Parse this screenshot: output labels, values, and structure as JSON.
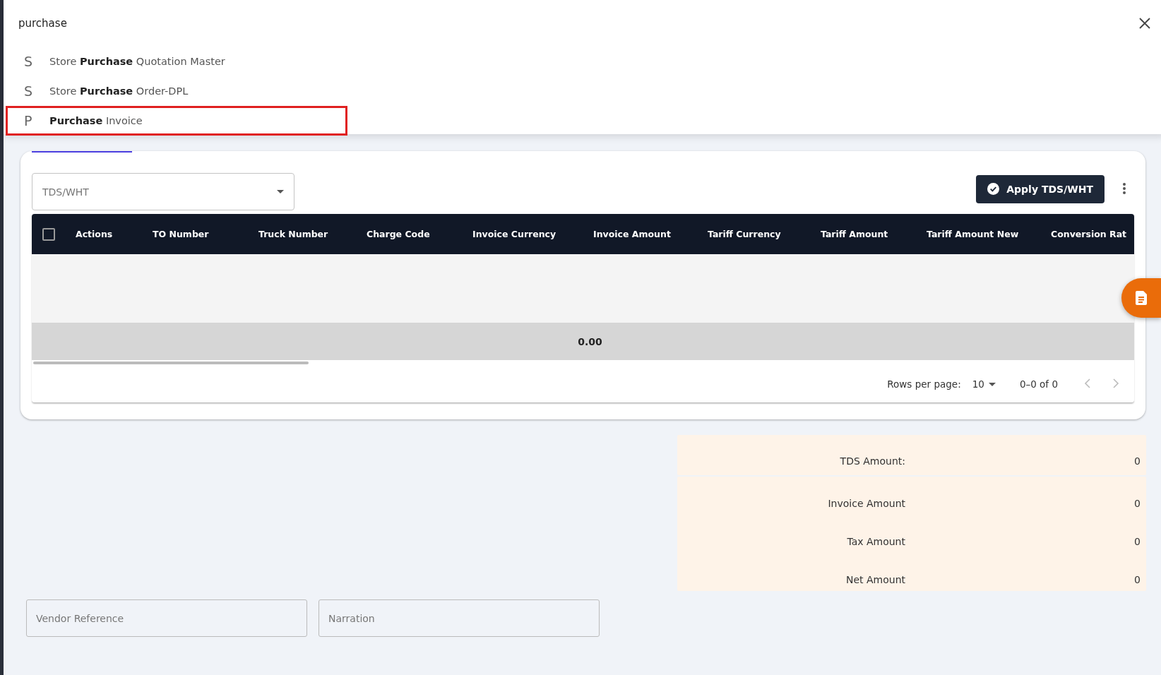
{
  "search": {
    "value": "purchase",
    "results": [
      {
        "letter": "S",
        "text": "Store **Purchase** Quotation Master",
        "selected": false
      },
      {
        "letter": "S",
        "text": "Store **Purchase** Order-DPL",
        "selected": false
      },
      {
        "letter": "P",
        "text": "**Purchase** Invoice",
        "selected": true
      }
    ]
  },
  "tds_select": {
    "placeholder": "TDS/WHT"
  },
  "apply_button": "Apply TDS/WHT",
  "table": {
    "columns": [
      "Actions",
      "TO Number",
      "Truck Number",
      "Charge Code",
      "Invoice Currency",
      "Invoice Amount",
      "Tariff Currency",
      "Tariff Amount",
      "Tariff Amount New",
      "Conversion Rat"
    ],
    "select_all": {
      "checked": false
    },
    "total": "0.00"
  },
  "pagination": {
    "rows_label": "Rows per page:",
    "rows_value": "10",
    "range": "0–0 of 0"
  },
  "summary": {
    "tds": [
      {
        "label": "TDS Amount:",
        "value": "0"
      }
    ],
    "totals": [
      {
        "label": "Invoice Amount",
        "value": "0"
      },
      {
        "label": "Tax Amount",
        "value": "0"
      },
      {
        "label": "Net Amount",
        "value": "0"
      }
    ]
  },
  "fields": [
    {
      "placeholder": "Vendor Reference"
    },
    {
      "placeholder": "Narration"
    }
  ]
}
